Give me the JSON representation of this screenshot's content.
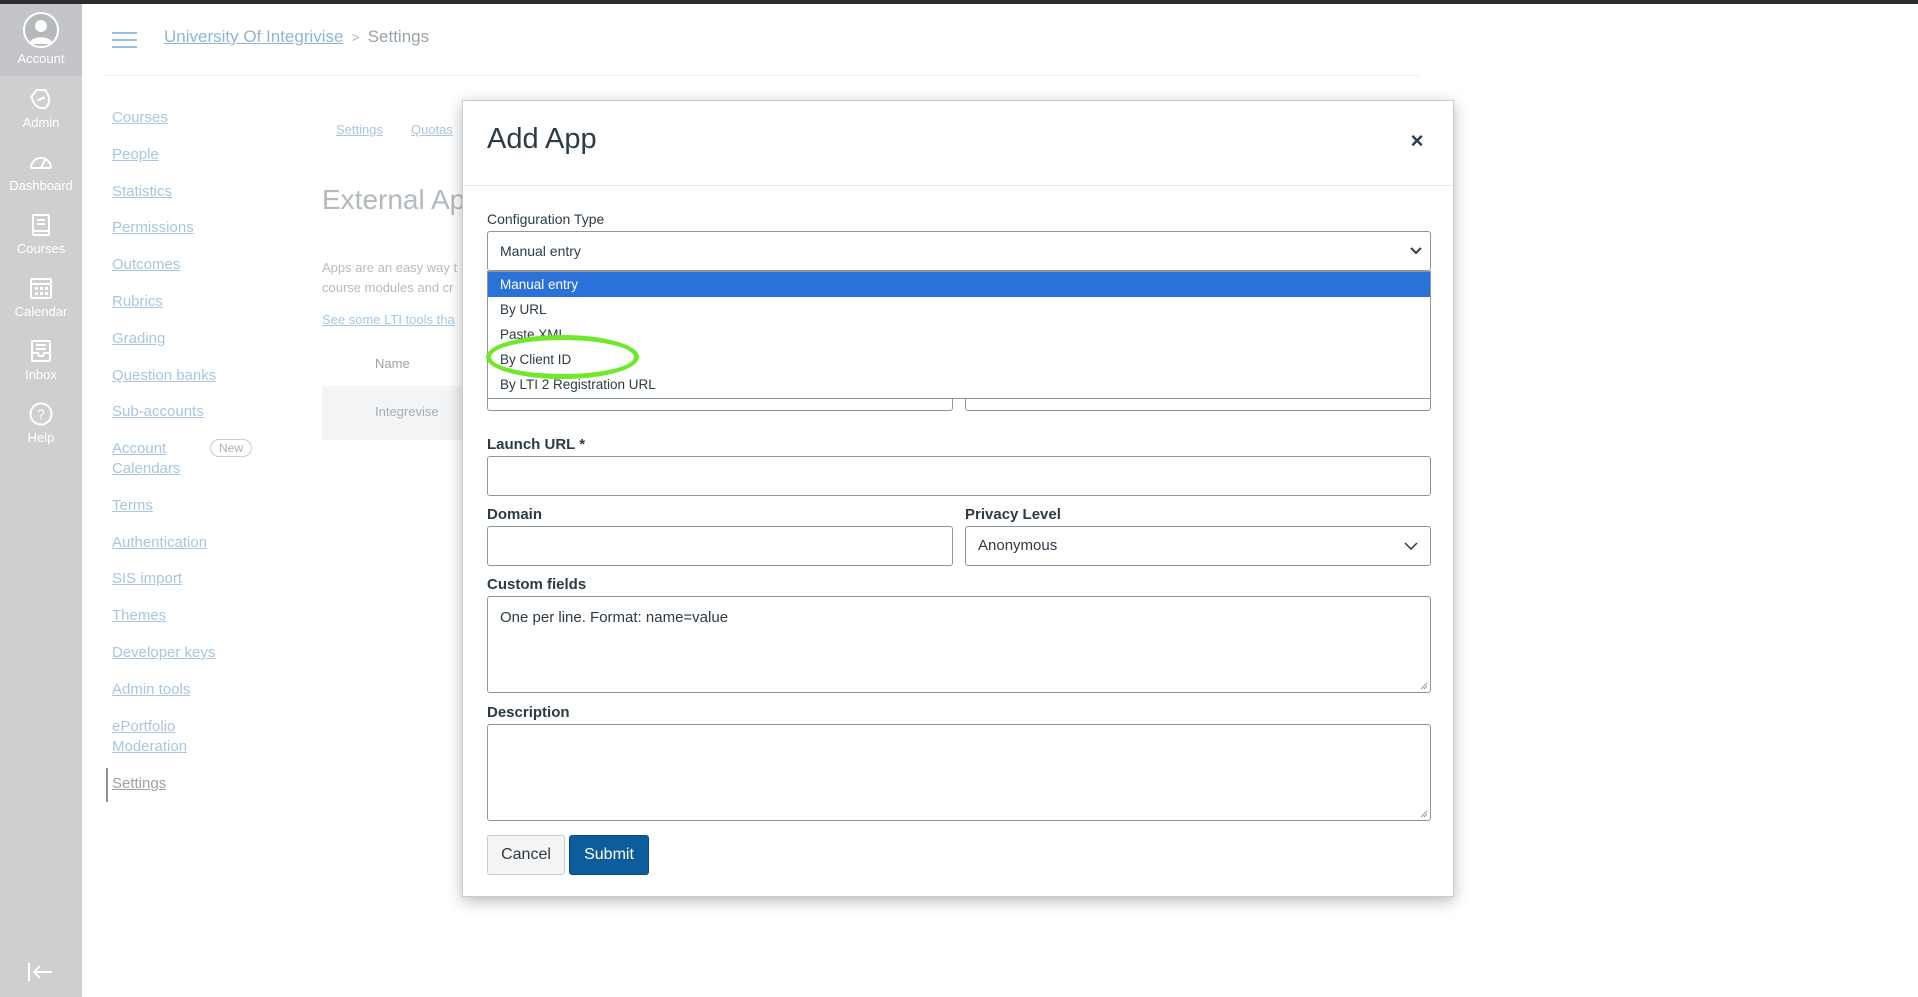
{
  "global_nav": {
    "items": [
      {
        "label": "Account",
        "icon": "account-icon"
      },
      {
        "label": "Admin",
        "icon": "shield-icon"
      },
      {
        "label": "Dashboard",
        "icon": "dashboard-icon"
      },
      {
        "label": "Courses",
        "icon": "courses-icon"
      },
      {
        "label": "Calendar",
        "icon": "calendar-icon"
      },
      {
        "label": "Inbox",
        "icon": "inbox-icon"
      },
      {
        "label": "Help",
        "icon": "help-icon"
      }
    ],
    "collapse_icon": "collapse-nav-icon"
  },
  "header": {
    "breadcrumb": [
      "University Of Integrivise",
      "Settings"
    ]
  },
  "account_nav": {
    "items": [
      "Courses",
      "People",
      "Statistics",
      "Permissions",
      "Outcomes",
      "Rubrics",
      "Grading",
      "Question banks",
      "Sub-accounts",
      "Account Calendars",
      "Terms",
      "Authentication",
      "SIS import",
      "Themes",
      "Developer keys",
      "Admin tools",
      "ePortfolio Moderation",
      "Settings"
    ],
    "new_badge": "New"
  },
  "background_page": {
    "subtabs": [
      "Settings",
      "Quotas"
    ],
    "title": "External Ap",
    "description": "Apps are an easy way t course modules and cr",
    "link": "See some LTI tools tha",
    "table_header": "Name",
    "table_row": "Integrevise"
  },
  "modal": {
    "title": "Add App",
    "close_label": "×",
    "config_type_label": "Configuration Type",
    "config_type_value": "Manual entry",
    "config_options": [
      "Manual entry",
      "By URL",
      "Paste XML",
      "By Client ID",
      "By LTI 2 Registration URL"
    ],
    "launch_url_label": "Launch URL *",
    "launch_url_value": "",
    "domain_label": "Domain",
    "domain_value": "",
    "privacy_label": "Privacy Level",
    "privacy_value": "Anonymous",
    "custom_fields_label": "Custom fields",
    "custom_fields_placeholder": "One per line. Format: name=value",
    "description_label": "Description",
    "description_value": "",
    "cancel_label": "Cancel",
    "submit_label": "Submit"
  },
  "colors": {
    "selected_option": "#2a71d8",
    "submit_button": "#0d5d9c",
    "annotation_circle": "#6fe82a",
    "global_nav_bg": "#cdcfd1"
  }
}
